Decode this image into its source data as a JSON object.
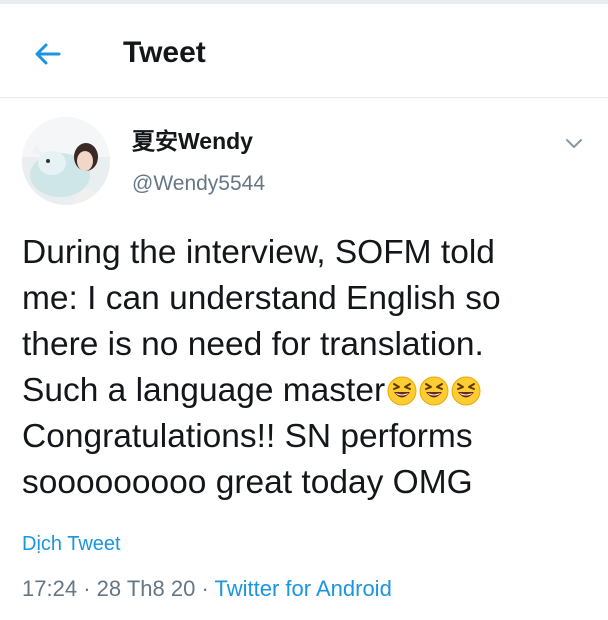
{
  "header": {
    "title": "Tweet"
  },
  "icons": {
    "back": "arrow-left-icon",
    "menu": "chevron-down-icon",
    "emoji": "grinning-squinting-face-emoji"
  },
  "colors": {
    "accent": "#1b95e0",
    "text": "#14171a",
    "secondary": "#657786",
    "divider": "#e6ecf0"
  },
  "author": {
    "name": "夏安Wendy",
    "handle": "@Wendy5544"
  },
  "tweet": {
    "lines": [
      "During the interview, SOFM told",
      "me: I can understand English so",
      "there is no need for translation.",
      "Such a language master",
      "Congratulations!! SN performs",
      "sooooooooo great today OMG"
    ],
    "translate_label": "Dịch Tweet",
    "time": "17:24",
    "separator": "·",
    "date": "28 Th8 20",
    "source": "Twitter for Android"
  }
}
